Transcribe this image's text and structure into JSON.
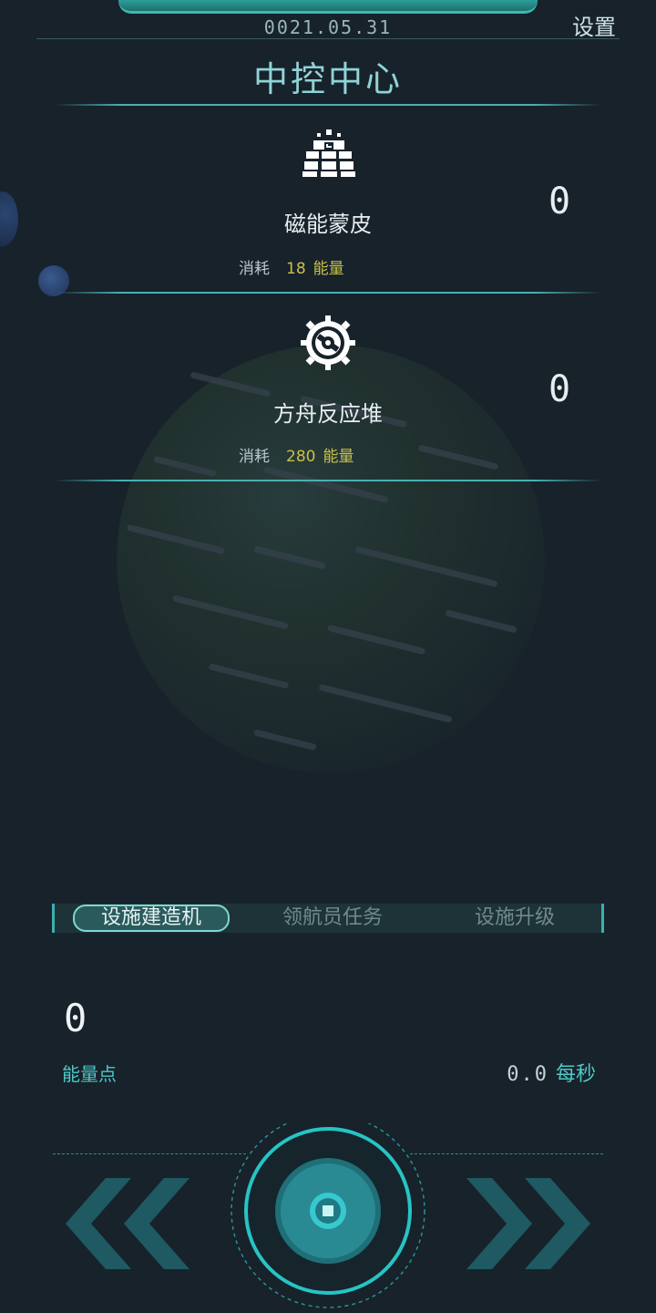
{
  "header": {
    "date": "0021.05.31",
    "settings_label": "设置",
    "title": "中控中心"
  },
  "facilities": [
    {
      "name": "磁能蒙皮",
      "cost_label": "消耗",
      "cost_value": "18",
      "cost_unit": "能量",
      "count": "0",
      "icon": "solar-panel-icon"
    },
    {
      "name": "方舟反应堆",
      "cost_label": "消耗",
      "cost_value": "280",
      "cost_unit": "能量",
      "count": "0",
      "icon": "gear-reactor-icon"
    }
  ],
  "tabs": [
    {
      "label": "设施建造机",
      "active": true
    },
    {
      "label": "领航员任务",
      "active": false
    },
    {
      "label": "设施升级",
      "active": false
    }
  ],
  "energy": {
    "value": "0",
    "label": "能量点",
    "rate_value": "0.0",
    "rate_unit": "每秒"
  },
  "colors": {
    "accent": "#4ec8c6",
    "cost": "#c8c14a",
    "background": "#17222b"
  }
}
